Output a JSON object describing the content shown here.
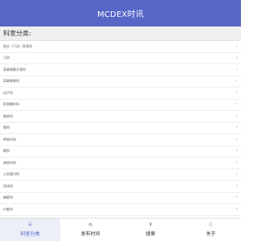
{
  "header": {
    "title": "MCDEX时讯"
  },
  "section": {
    "title": "科室分类:"
  },
  "list": {
    "items": [
      {
        "label": "急诊（门诊）危急科"
      },
      {
        "label": "儿科"
      },
      {
        "label": "耳鼻咽喉头颈科"
      },
      {
        "label": "耳鼻咽喉科"
      },
      {
        "label": "妇产科"
      },
      {
        "label": "肝胆胰外科"
      },
      {
        "label": "感染科"
      },
      {
        "label": "骨科"
      },
      {
        "label": "呼吸内科"
      },
      {
        "label": "眼科"
      },
      {
        "label": "神经内科"
      },
      {
        "label": "心血管内科"
      },
      {
        "label": "消化科"
      },
      {
        "label": "麻醉科"
      },
      {
        "label": "口腔科"
      },
      {
        "label": "泌尿外科"
      }
    ]
  },
  "tabs": [
    {
      "label": "科室分类",
      "icon": "list-icon",
      "glyph": "☰",
      "active": true
    },
    {
      "label": "发布时间",
      "icon": "clock-icon",
      "glyph": "◷",
      "active": false
    },
    {
      "label": "搜索",
      "icon": "search-icon",
      "glyph": "⚲",
      "active": false
    },
    {
      "label": "关于",
      "icon": "info-icon",
      "glyph": "ⓘ",
      "active": false
    }
  ],
  "colors": {
    "header_bg": "#5866c8",
    "accent": "#5866c8",
    "section_bg": "#efefef"
  }
}
